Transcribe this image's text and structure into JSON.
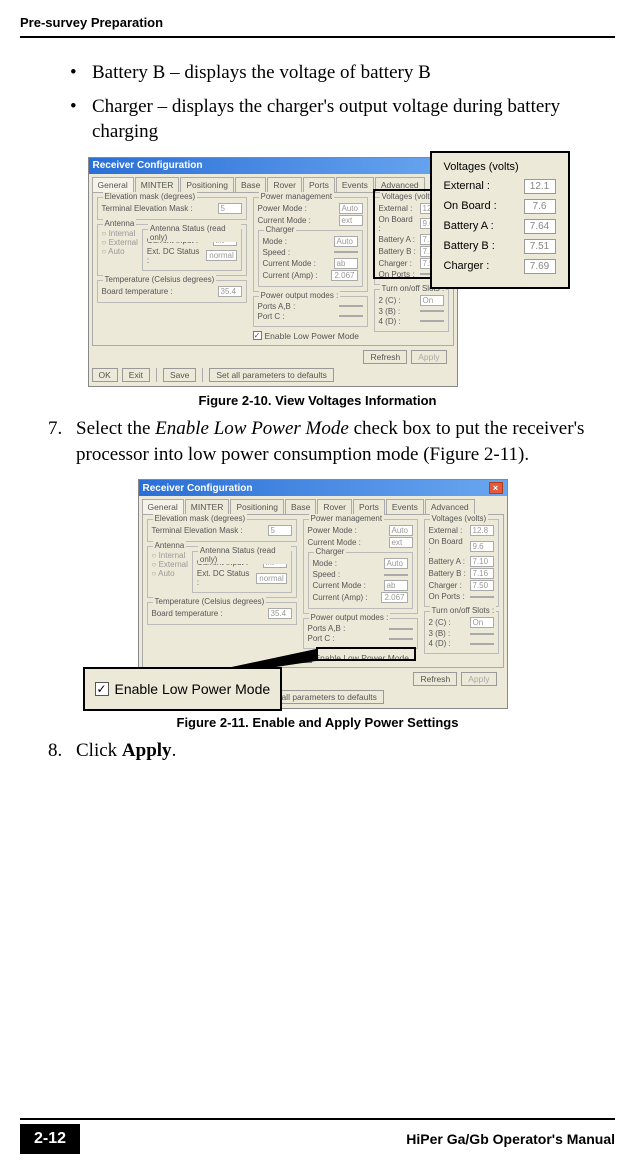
{
  "header": {
    "section": "Pre-survey Preparation"
  },
  "bullets": [
    "Battery B – displays the voltage of battery B",
    "Charger – displays the charger's output voltage during battery charging"
  ],
  "fig1": {
    "dialog_title": "Receiver Configuration",
    "tabs": [
      "General",
      "MINTER",
      "Positioning",
      "Base",
      "Rover",
      "Ports",
      "Events",
      "Advanced"
    ],
    "elevation": {
      "group": "Elevation mask (degrees)",
      "label": "Terminal Elevation Mask :",
      "value": "5"
    },
    "antenna": {
      "group": "Antenna",
      "radios": [
        "Internal",
        "External",
        "Auto"
      ],
      "status_group": "Antenna Status (read only)",
      "current_input_label": "Current Input :",
      "current_input_value": "int",
      "ext_dc_label": "Ext. DC Status :",
      "ext_dc_value": "normal"
    },
    "temperature": {
      "group": "Temperature (Celsius degrees)",
      "label": "Board temperature :",
      "value": "35.4"
    },
    "power_mgmt": {
      "group": "Power management",
      "power_mode_label": "Power Mode :",
      "power_mode_value": "Auto",
      "current_mode_label": "Current Mode :",
      "current_mode_value": "ext",
      "charger_group": "Charger",
      "charger_mode_label": "Mode :",
      "charger_mode_value": "Auto",
      "speed_label": "Speed :",
      "current_mode2_label": "Current Mode :",
      "current_mode2_value": "ab",
      "current_amp_label": "Current (Amp) :",
      "current_amp_value": "2.067"
    },
    "voltages": {
      "group": "Voltages (volts)",
      "rows": [
        {
          "label": "External :",
          "value": "12.8"
        },
        {
          "label": "On Board :",
          "value": "9.6"
        },
        {
          "label": "Battery A :",
          "value": "7.10"
        },
        {
          "label": "Battery B :",
          "value": "7.16"
        },
        {
          "label": "Charger :",
          "value": "7.50"
        },
        {
          "label": "On Ports :",
          "value": ""
        }
      ]
    },
    "power_output": {
      "group": "Power output modes :",
      "ports_ab": "Ports A,B :",
      "port_c": "Port C :"
    },
    "slots": {
      "group": "Turn on/off Slots :",
      "r1_label": "2 (C) :",
      "r1_value": "On",
      "r2_label": "3 (B) :",
      "r3_label": "4 (D) :"
    },
    "enable_lpm": "Enable Low Power Mode",
    "btn_refresh": "Refresh",
    "btn_apply": "Apply",
    "btn_ok": "OK",
    "btn_exit": "Exit",
    "btn_save": "Save",
    "btn_defaults": "Set all parameters to defaults",
    "caption": "Figure 2-10. View Voltages Information"
  },
  "zoom_voltages": {
    "title": "Voltages (volts)",
    "rows": [
      {
        "label": "External :",
        "value": "12.1"
      },
      {
        "label": "On Board :",
        "value": "7.6"
      },
      {
        "label": "Battery A :",
        "value": "7.64"
      },
      {
        "label": "Battery B :",
        "value": "7.51"
      },
      {
        "label": "Charger :",
        "value": "7.69"
      }
    ]
  },
  "step7": {
    "num": "7.",
    "text_a": "Select the ",
    "text_em": "Enable Low Power Mode",
    "text_b": " check box to put the receiver's processor into low power consumption mode (Figure 2-11)."
  },
  "fig2": {
    "caption": "Figure 2-11. Enable and Apply Power Settings",
    "zoom_label": "Enable Low Power Mode"
  },
  "step8": {
    "num": "8.",
    "text_a": "Click ",
    "text_b": "Apply",
    "text_c": "."
  },
  "footer": {
    "page": "2-12",
    "manual": "HiPer Ga/Gb Operator's Manual"
  }
}
